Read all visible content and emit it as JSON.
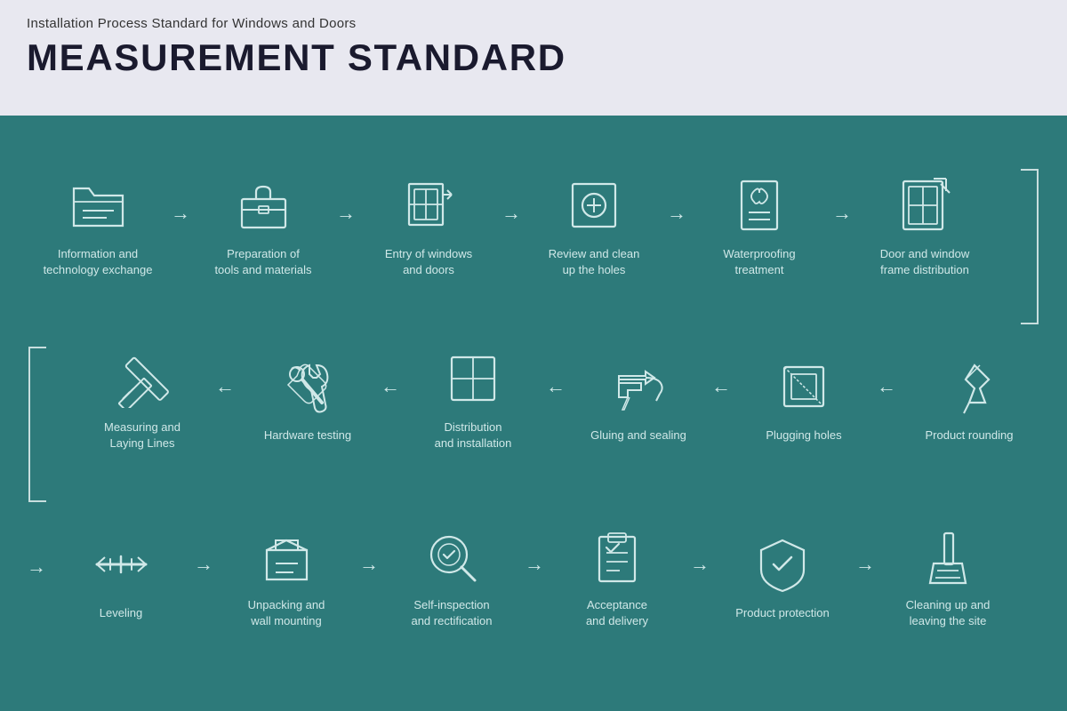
{
  "header": {
    "subtitle": "Installation Process Standard for Windows and Doors",
    "title": "MEASUREMENT STANDARD"
  },
  "colors": {
    "header_bg": "#e8e8f0",
    "main_bg": "#2d7a7a",
    "text_light": "#d0e8e8",
    "header_title": "#1a1a2e"
  },
  "row1": [
    {
      "id": "info-exchange",
      "label": "Information and\ntechnology exchange",
      "icon": "folder"
    },
    {
      "id": "tools-prep",
      "label": "Preparation of\ntools and materials",
      "icon": "toolbox"
    },
    {
      "id": "entry-windows",
      "label": "Entry of windows\nand doors",
      "icon": "window-entry"
    },
    {
      "id": "review-holes",
      "label": "Review and clean\nup the holes",
      "icon": "search-magnify"
    },
    {
      "id": "waterproofing",
      "label": "Waterproofing\ntreatment",
      "icon": "waterproof"
    },
    {
      "id": "frame-dist",
      "label": "Door and window\nframe distribution",
      "icon": "frame-export"
    }
  ],
  "row2": [
    {
      "id": "measuring",
      "label": "Measuring and\nLaying Lines",
      "icon": "pencil-ruler"
    },
    {
      "id": "hardware-test",
      "label": "Hardware testing",
      "icon": "wrench"
    },
    {
      "id": "distribution",
      "label": "Distribution\nand installation",
      "icon": "grid-layout"
    },
    {
      "id": "gluing",
      "label": "Gluing and sealing",
      "icon": "glue-gun"
    },
    {
      "id": "plugging",
      "label": "Plugging holes",
      "icon": "plug-hole"
    },
    {
      "id": "rounding",
      "label": "Product rounding",
      "icon": "pushpin"
    }
  ],
  "row3": [
    {
      "id": "leveling",
      "label": "Leveling",
      "icon": "level"
    },
    {
      "id": "unpacking",
      "label": "Unpacking and\nwall mounting",
      "icon": "box-unpack"
    },
    {
      "id": "self-inspect",
      "label": "Self-inspection\nand rectification",
      "icon": "search-check"
    },
    {
      "id": "acceptance",
      "label": "Acceptance\nand delivery",
      "icon": "clipboard-check"
    },
    {
      "id": "product-protect",
      "label": "Product protection",
      "icon": "shield-check"
    },
    {
      "id": "cleaning",
      "label": "Cleaning up and\nleaving the site",
      "icon": "broom"
    }
  ]
}
